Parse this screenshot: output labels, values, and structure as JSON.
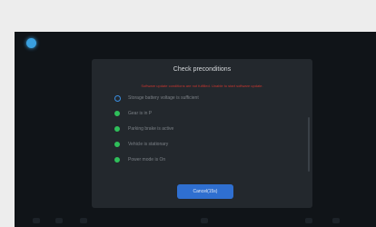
{
  "dialog": {
    "title": "Check preconditions",
    "warning": "Software update conditions are not fulfilled. Unable to start software update.",
    "cancel_label": "Cancel(15s)"
  },
  "checklist": [
    {
      "label": "Storage battery voltage is sufficient",
      "status": "pending"
    },
    {
      "label": "Gear is in P",
      "status": "ok"
    },
    {
      "label": "Parking brake is active",
      "status": "ok"
    },
    {
      "label": "Vehicle is stationary",
      "status": "ok"
    },
    {
      "label": "Power mode is On",
      "status": "ok"
    }
  ],
  "colors": {
    "accent": "#2f6fd0",
    "ok": "#2fbf5a",
    "pending": "#3a8ee0",
    "warning": "#c8362f"
  }
}
